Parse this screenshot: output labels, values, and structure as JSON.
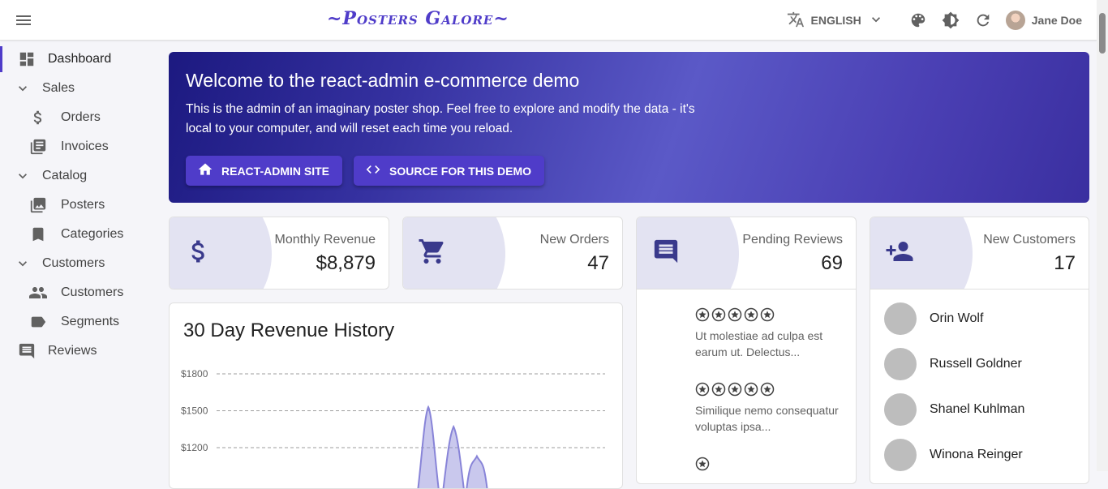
{
  "appbar": {
    "brand": "~Posters Galore~",
    "language": "ENGLISH",
    "user_name": "Jane Doe"
  },
  "sidebar": {
    "dashboard": "Dashboard",
    "sales": "Sales",
    "orders": "Orders",
    "invoices": "Invoices",
    "catalog": "Catalog",
    "posters": "Posters",
    "categories": "Categories",
    "customers_group": "Customers",
    "customers": "Customers",
    "segments": "Segments",
    "reviews": "Reviews"
  },
  "welcome": {
    "title": "Welcome to the react-admin e-commerce demo",
    "text": "This is the admin of an imaginary poster shop. Feel free to explore and modify the data - it's local to your computer, and will reset each time you reload.",
    "site_button": "REACT-ADMIN SITE",
    "source_button": "SOURCE FOR THIS DEMO"
  },
  "stats": {
    "revenue_label": "Monthly Revenue",
    "revenue_value": "$8,879",
    "orders_label": "New Orders",
    "orders_value": "47",
    "reviews_label": "Pending Reviews",
    "reviews_value": "69",
    "customers_label": "New Customers",
    "customers_value": "17"
  },
  "revenue_chart": {
    "title": "30 Day Revenue History"
  },
  "chart_data": {
    "type": "area",
    "title": "30 Day Revenue History",
    "yticks": [
      "$1800",
      "$1500",
      "$1200"
    ],
    "ylim": [
      900,
      1800
    ],
    "grid": true,
    "peaks": [
      {
        "x": 0.545,
        "value": 1530
      },
      {
        "x": 0.61,
        "value": 1370
      },
      {
        "x": 0.67,
        "value": 1130
      }
    ]
  },
  "reviews": [
    {
      "rating": 5,
      "text": "Ut molestiae ad culpa est earum ut. Delectus..."
    },
    {
      "rating": 5,
      "text": "Similique nemo consequatur voluptas ipsa..."
    },
    {
      "rating": 1,
      "text": ""
    }
  ],
  "customers": [
    {
      "name": "Orin Wolf"
    },
    {
      "name": "Russell Goldner"
    },
    {
      "name": "Shanel Kuhlman"
    },
    {
      "name": "Winona Reinger"
    }
  ],
  "colors": {
    "primary": "#4f3cc9",
    "bubble": "#e3e3f2",
    "icon": "#3a3a8c"
  }
}
